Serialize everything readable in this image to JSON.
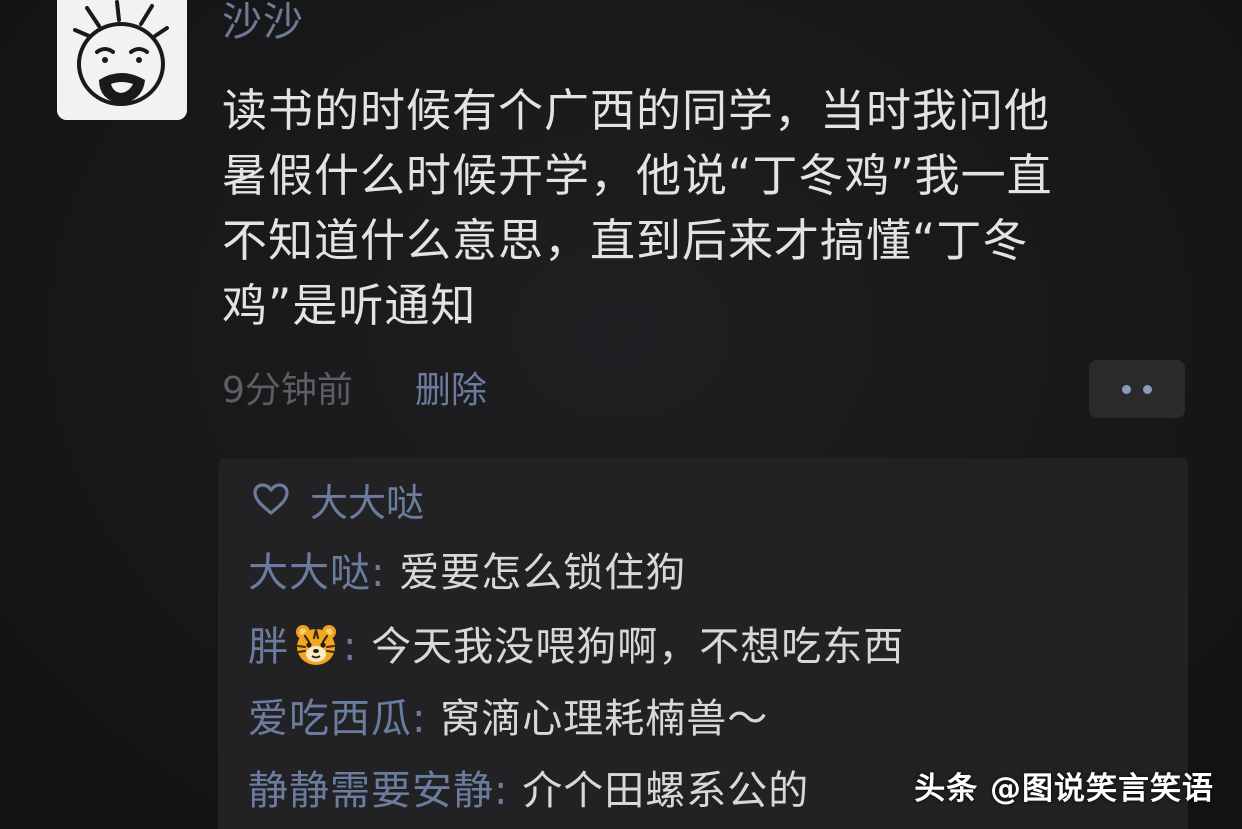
{
  "post": {
    "username": "沙沙",
    "avatar_icon": "cartoon-face-avatar",
    "text_lines": [
      "读书的时候有个广西的同学，当时我问他",
      "暑假什么时候开学，他说“丁冬鸡”我一直",
      "不知道什么意思，直到后来才搞懂“丁冬",
      "鸡”是听通知"
    ],
    "time": "9分钟前",
    "delete_label": "删除",
    "more_icon": "more-dots-icon"
  },
  "likes": {
    "icon": "heart-icon",
    "names": "大大哒"
  },
  "comments": [
    {
      "author": "大大哒",
      "text": "爱要怎么锁住狗"
    },
    {
      "author": "胖",
      "author_emoji": "tiger-face-icon",
      "text": "今天我没喂狗啊，不想吃东西"
    },
    {
      "author": "爱吃西瓜",
      "text": "窝滴心理耗楠兽～"
    },
    {
      "author": "静静需要安静",
      "text": "介个田螺系公的"
    }
  ],
  "separator": ": ",
  "watermark": "头条 @图说笑言笑语",
  "colors": {
    "background": "#1a1a1c",
    "name_blue": "#6b7c9e",
    "text": "#e3e3e3",
    "muted": "#5e5e62"
  }
}
